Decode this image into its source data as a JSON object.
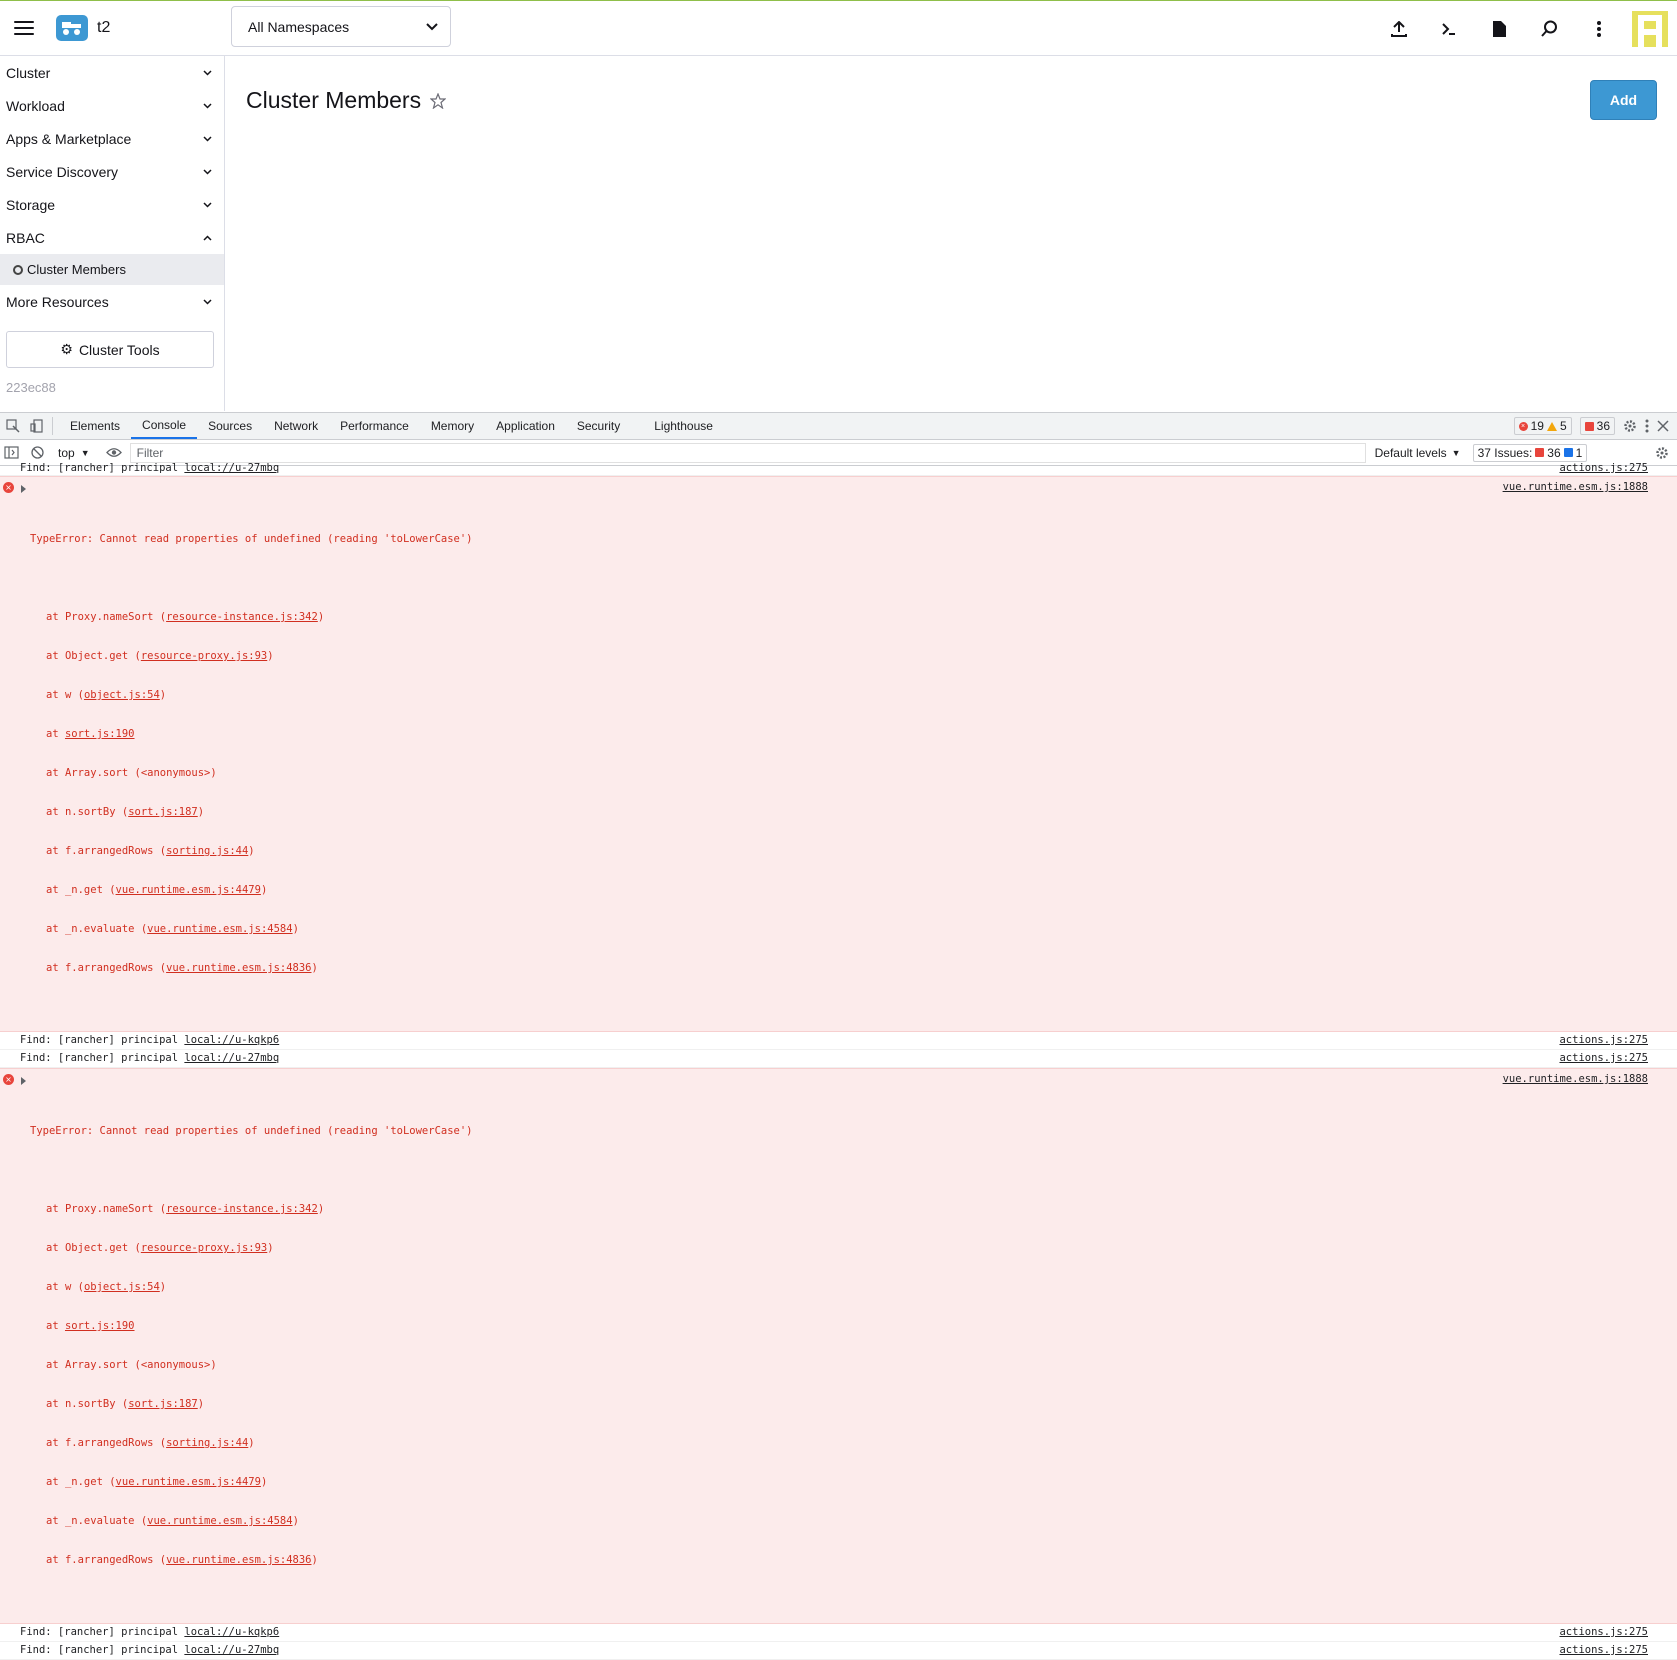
{
  "header": {
    "cluster_name": "t2",
    "namespace_select": "All Namespaces",
    "icons": [
      "upload-icon",
      "terminal-icon",
      "file-icon",
      "search-icon",
      "kebab-menu-icon"
    ]
  },
  "sidebar": {
    "groups": [
      {
        "label": "Cluster"
      },
      {
        "label": "Workload"
      },
      {
        "label": "Apps & Marketplace"
      },
      {
        "label": "Service Discovery"
      },
      {
        "label": "Storage"
      },
      {
        "label": "RBAC"
      },
      {
        "label": "More Resources"
      }
    ],
    "rbac_child": "Cluster Members",
    "tools_button": "Cluster Tools",
    "version": "223ec88"
  },
  "main": {
    "title": "Cluster Members",
    "add_button": "Add"
  },
  "devtools": {
    "tabs": [
      "Elements",
      "Console",
      "Sources",
      "Network",
      "Performance",
      "Memory",
      "Application",
      "Security",
      "Lighthouse"
    ],
    "active_tab": "Console",
    "errors_count": "19",
    "warnings_count": "5",
    "issues_red_count": "36",
    "context": "top",
    "filter_placeholder": "Filter",
    "levels": "Default levels",
    "issues_label": "37 Issues:",
    "issues_red": "36",
    "issues_blue": "1",
    "colors": {
      "error_bg": "#fcebeb",
      "error_text": "#d12f20",
      "accent": "#1a73e8",
      "primary": "#3d98d3"
    }
  },
  "console": {
    "line1": {
      "text": "Find: [rancher] principal ",
      "link": "local://u-27mbq",
      "src": "actions.js:275"
    },
    "error1": {
      "message": "TypeError: Cannot read properties of undefined (reading 'toLowerCase')",
      "src": "vue.runtime.esm.js:1888",
      "stack": [
        {
          "pre": "at Proxy.nameSort (",
          "link": "resource-instance.js:342",
          "post": ")"
        },
        {
          "pre": "at Object.get (",
          "link": "resource-proxy.js:93",
          "post": ")"
        },
        {
          "pre": "at w (",
          "link": "object.js:54",
          "post": ")"
        },
        {
          "pre": "at ",
          "link": "sort.js:190",
          "post": ""
        },
        {
          "pre": "at Array.sort (<anonymous>)",
          "link": "",
          "post": ""
        },
        {
          "pre": "at n.sortBy (",
          "link": "sort.js:187",
          "post": ")"
        },
        {
          "pre": "at f.arrangedRows (",
          "link": "sorting.js:44",
          "post": ")"
        },
        {
          "pre": "at _n.get (",
          "link": "vue.runtime.esm.js:4479",
          "post": ")"
        },
        {
          "pre": "at _n.evaluate (",
          "link": "vue.runtime.esm.js:4584",
          "post": ")"
        },
        {
          "pre": "at f.arrangedRows (",
          "link": "vue.runtime.esm.js:4836",
          "post": ")"
        }
      ]
    },
    "line2": {
      "text": "Find: [rancher] principal ",
      "link": "local://u-kqkp6",
      "src": "actions.js:275"
    },
    "line3": {
      "text": "Find: [rancher] principal ",
      "link": "local://u-27mbq",
      "src": "actions.js:275"
    },
    "line4": {
      "text": "Find: [rancher] principal ",
      "link": "local://u-kqkp6",
      "src": "actions.js:275"
    },
    "line5": {
      "text": "Find: [rancher] principal ",
      "link": "local://u-27mbq",
      "src": "actions.js:275"
    }
  }
}
